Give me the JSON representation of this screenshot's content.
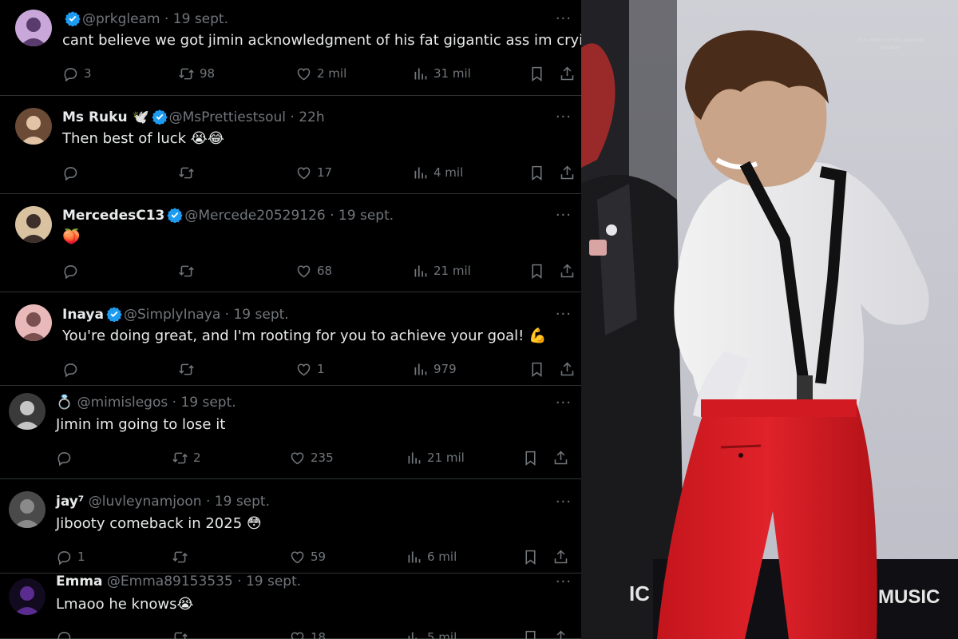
{
  "tweets": [
    {
      "name": "",
      "verified": true,
      "handle": "@prkgleam",
      "date": " · 19 sept.",
      "text": "cant believe we got jimin acknowledgment of his fat gigantic ass im crying",
      "replies": "3",
      "retweets": "98",
      "likes": "2 mil",
      "views": "31 mil"
    },
    {
      "name": "Ms Ruku 🕊️",
      "verified": true,
      "handle": "@MsPrettiestsoul",
      "date": " · 22h",
      "text": "Then best of luck 😭😂",
      "replies": "",
      "retweets": "",
      "likes": "17",
      "views": "4 mil"
    },
    {
      "name": "MercedesC13",
      "verified": true,
      "handle": "@Mercede20529126",
      "date": " · 19 sept.",
      "text": "🍑",
      "replies": "",
      "retweets": "",
      "likes": "68",
      "views": "21 mil"
    },
    {
      "name": "Inaya",
      "verified": true,
      "handle": "@SimplyInaya",
      "date": " · 19 sept.",
      "text": "You're doing great, and I'm rooting for you to achieve your goal! 💪",
      "replies": "",
      "retweets": "",
      "likes": "1",
      "views": "979"
    },
    {
      "name": "💍",
      "verified": false,
      "handle": "@mimislegos",
      "date": " · 19 sept.",
      "text": "Jimin im going to lose it",
      "replies": "",
      "retweets": "2",
      "likes": "235",
      "views": "21 mil"
    },
    {
      "name": "jay⁷",
      "verified": false,
      "handle": "@luvleynamjoon",
      "date": " · 19 sept.",
      "text": "Jibooty comeback in 2025 😳",
      "replies": "1",
      "retweets": "",
      "likes": "59",
      "views": "6 mil"
    },
    {
      "name": "Emma",
      "verified": false,
      "handle": "@Emma89153535",
      "date": " · 19 sept.",
      "text": "Lmaoo he knows😭",
      "replies": "",
      "retweets": "",
      "likes": "18",
      "views": "5 mil"
    }
  ],
  "more_label": "···",
  "photo": {
    "watermark_line1": "BTS JIMIN FAN SITE JAMJAM",
    "watermark_line2": "jamjam.kr",
    "backdrop_text_left": "IC",
    "backdrop_text_right": "MUSIC"
  },
  "colors": {
    "verified": "#1d9bf0",
    "muted": "#71767b",
    "text": "#e7e9ea",
    "divider": "#2f3336"
  }
}
